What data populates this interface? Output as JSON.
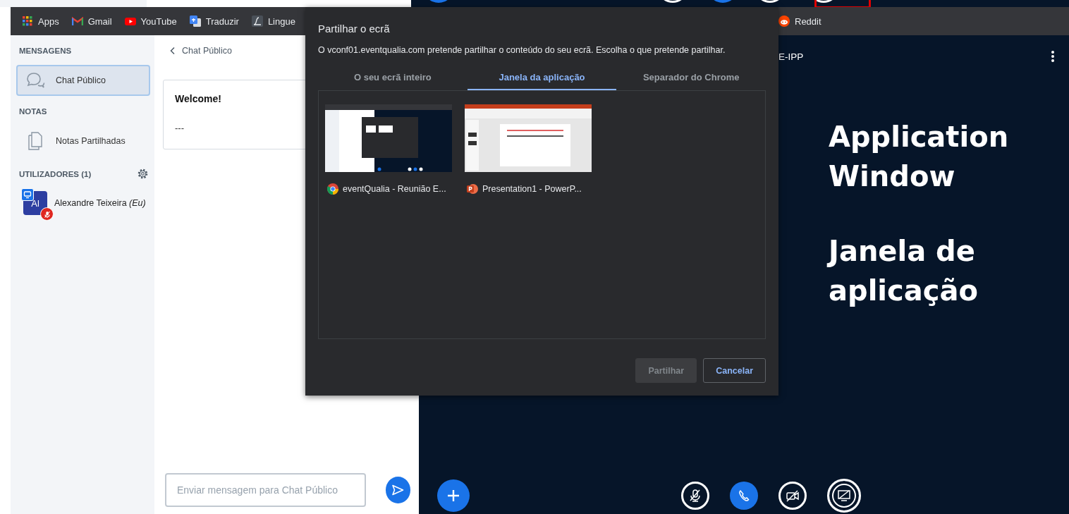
{
  "bookmarks": [
    {
      "label": "Apps"
    },
    {
      "label": "Gmail"
    },
    {
      "label": "YouTube"
    },
    {
      "label": "Traduzir"
    },
    {
      "label": "Lingue"
    },
    {
      "label": "Reddit"
    }
  ],
  "sidebar": {
    "messages": {
      "title": "MENSAGENS",
      "items": [
        {
          "label": "Chat Público",
          "selected": true
        }
      ]
    },
    "notes": {
      "title": "NOTAS",
      "items": [
        {
          "label": "Notas Partilhadas",
          "selected": false
        }
      ]
    },
    "users": {
      "title": "UTILIZADORES (1)",
      "list": [
        {
          "initials": "Al",
          "name": "Alexandre Teixeira *(Eu)*",
          "presenter": true,
          "muted": true
        }
      ]
    }
  },
  "chat": {
    "title": "Chat Público",
    "messages": [
      {
        "title": "Welcome!",
        "body": "---"
      }
    ],
    "input": {
      "placeholder": "Enviar mensagem para Chat Público"
    }
  },
  "stage": {
    "title": "E-IPP",
    "annotation": [
      "Application Window",
      "Janela de aplicação"
    ],
    "controls": [
      {
        "kind": "add"
      },
      {
        "kind": "mic-off"
      },
      {
        "kind": "phone"
      },
      {
        "kind": "camera-off"
      },
      {
        "kind": "screen"
      }
    ]
  },
  "dialog": {
    "title": "Partilhar o ecrã",
    "description": "O vconf01.eventqualia.com pretende partilhar o conteúdo do seu ecrã. Escolha o que pretende partilhar.",
    "tabs": [
      {
        "label": "O seu ecrã inteiro",
        "selected": false
      },
      {
        "label": "Janela da aplicação",
        "selected": true
      },
      {
        "label": "Separador do Chrome",
        "selected": false
      }
    ],
    "sources": [
      {
        "label": "eventQualia - Reunião E..."
      },
      {
        "label": "Presentation1 - PowerP..."
      }
    ],
    "buttons": [
      {
        "label": "Partilhar",
        "kind": "primary",
        "disabled": true
      },
      {
        "label": "Cancelar",
        "kind": "secondary",
        "disabled": false
      }
    ]
  }
}
